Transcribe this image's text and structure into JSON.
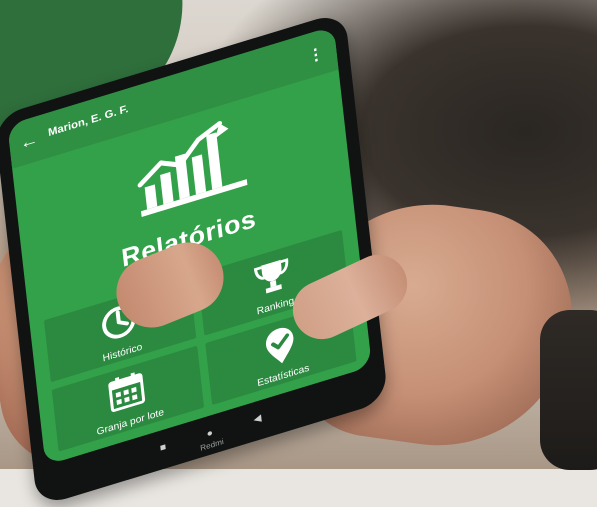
{
  "app": {
    "top_title": "Marion, E. G. F.",
    "hero_title": "Relatórios",
    "tiles": [
      {
        "label": "Histórico",
        "icon": "history-icon"
      },
      {
        "label": "Ranking",
        "icon": "trophy-icon"
      },
      {
        "label": "Granja por lote",
        "icon": "calendar-icon"
      },
      {
        "label": "Estatísticas",
        "icon": "location-check-icon"
      }
    ],
    "device_brand": "Redmi"
  },
  "colors": {
    "screen_green": "#33a14a",
    "tile_green": "#2b8a40",
    "topbar_green": "#2f8f43",
    "corner_green": "#2f6f3c"
  }
}
